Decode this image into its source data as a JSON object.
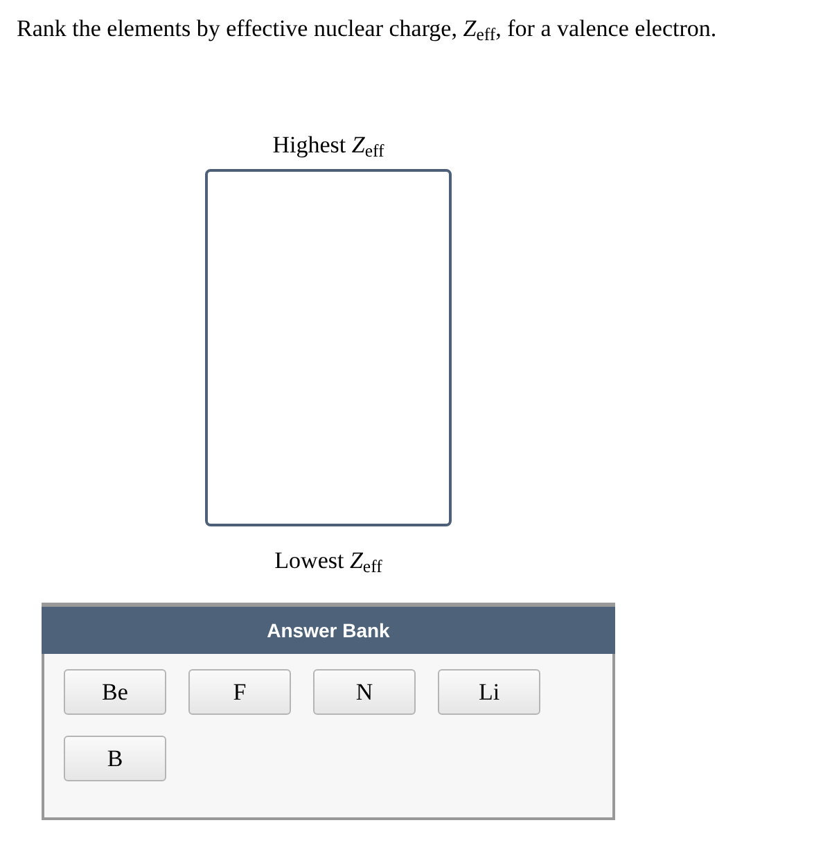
{
  "question": "Rank the elements by effective nuclear charge, *Z*$_{eff}$, for a valence electron.",
  "ranking": {
    "top_label": "Highest *Z*$_{eff}$",
    "bottom_label": "Lowest *Z*$_{eff}$"
  },
  "answer_bank": {
    "title": "Answer Bank",
    "items": [
      "Be",
      "F",
      "N",
      "Li",
      "B"
    ]
  }
}
